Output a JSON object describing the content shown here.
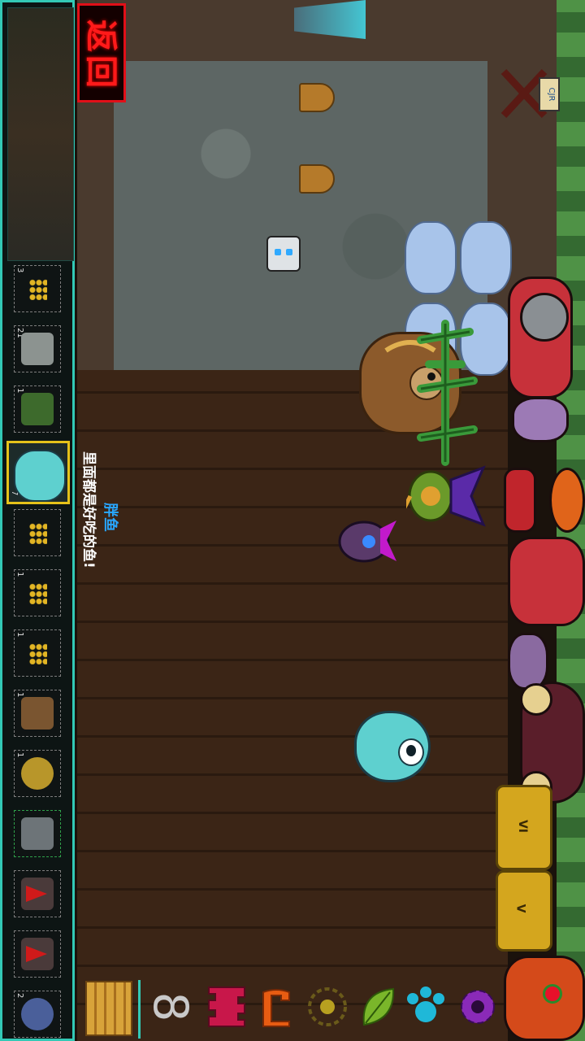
{
  "back_button": {
    "label": "返回"
  },
  "tooltip": {
    "name": "胖鱼",
    "description": "里面都是好吃的鱼!"
  },
  "item_slots": [
    {
      "name": "tower-dots",
      "count": "3"
    },
    {
      "name": "tombstone",
      "count": "21"
    },
    {
      "name": "green-trap",
      "count": "1"
    },
    {
      "name": "fat-fish",
      "count": "7",
      "selected": true
    },
    {
      "name": "tower-dots",
      "count": ""
    },
    {
      "name": "tower-dots",
      "count": "1"
    },
    {
      "name": "tower-dots",
      "count": "1"
    },
    {
      "name": "wooden-sign",
      "count": "1"
    },
    {
      "name": "golden-idol",
      "count": "1"
    },
    {
      "name": "stone-golem",
      "count": ""
    },
    {
      "name": "red-hat-gnome",
      "count": ""
    },
    {
      "name": "red-hat-gnome",
      "count": ""
    },
    {
      "name": "blue-orb",
      "count": "2"
    }
  ],
  "toolbar": {
    "infinity_symbol": "8",
    "icons": [
      "gate-icon",
      "infinity-icon",
      "castle-icon",
      "bracket-icon",
      "gear-dim-icon",
      "leaf-icon",
      "paw-icon",
      "gear-icon"
    ]
  },
  "lanes": [
    {
      "label": "VI"
    },
    {
      "label": "V"
    }
  ],
  "colors": {
    "itembar_border": "#33c9b6",
    "back_red": "#e10f18",
    "selected_slot": "#e5c21a",
    "tooltip_name": "#28a6ff"
  }
}
